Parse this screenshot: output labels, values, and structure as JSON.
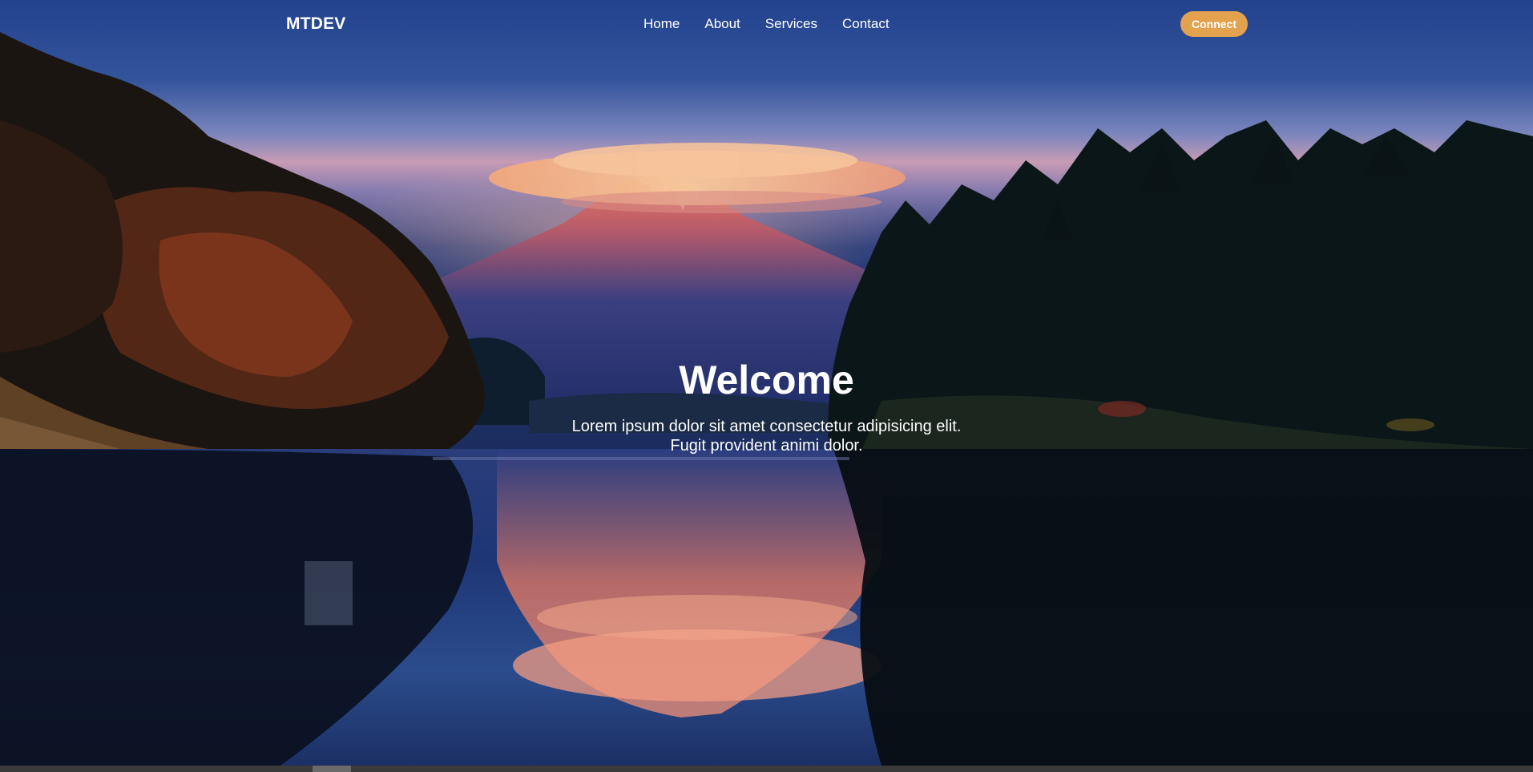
{
  "header": {
    "logo": "MTDEV",
    "nav": [
      {
        "label": "Home"
      },
      {
        "label": "About"
      },
      {
        "label": "Services"
      },
      {
        "label": "Contact"
      }
    ],
    "cta_label": "Connect"
  },
  "hero": {
    "title": "Welcome",
    "line1": "Lorem ipsum dolor sit amet consectetur adipisicing elit.",
    "line2": "Fugit provident animi dolor."
  },
  "background": {
    "icon": "mountain-lake-landscape-image"
  },
  "colors": {
    "accent": "#e3a24e",
    "text": "#ffffff"
  }
}
